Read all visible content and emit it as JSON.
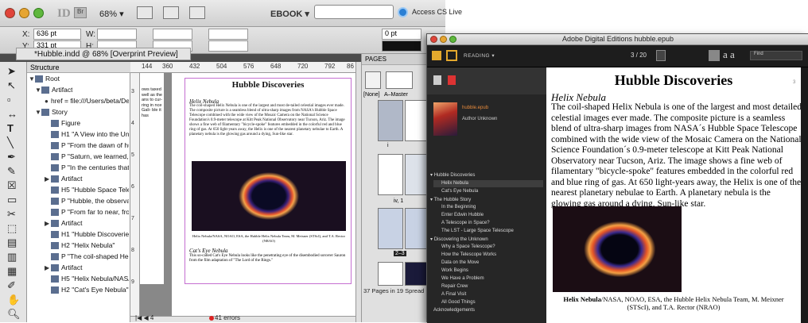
{
  "indesign": {
    "zoom": "68%",
    "ebook": "EBOOK ▾",
    "cs_live": "Access CS Live",
    "logo": "ID",
    "bridge": "Br",
    "control": {
      "x_label": "X:",
      "x_value": "636 pt",
      "y_label": "Y:",
      "y_value": "331 pt",
      "w_label": "W:",
      "h_label": "H:",
      "stroke_value": "0 pt"
    },
    "doc_tab": "*Hubble.indd @ 68% [Overprint Preview]",
    "structure": {
      "header": "Structure",
      "rows": [
        {
          "label": "Root"
        },
        {
          "label": "Artifact"
        },
        {
          "label": "href = file:///Users/beta/De"
        },
        {
          "label": "Story"
        },
        {
          "label": "Figure"
        },
        {
          "label": "H1  \"A View into the Uni"
        },
        {
          "label": "P  \"From the dawn of hu"
        },
        {
          "label": "P  \"Saturn, we learned, h"
        },
        {
          "label": "P  \"In the centuries that"
        },
        {
          "label": "Artifact"
        },
        {
          "label": "H5  \"Hubble Space Teles"
        },
        {
          "label": "P  \"Hubble, the observat"
        },
        {
          "label": "P  \"From far to near, fror"
        },
        {
          "label": "Artifact"
        },
        {
          "label": "H1  \"Hubble Discoveries"
        },
        {
          "label": "H2  \"Helix Nebula\""
        },
        {
          "label": "P  \"The coil-shaped Helix"
        },
        {
          "label": "Artifact"
        },
        {
          "label": "H5  \"Helix Nebula/NASA"
        },
        {
          "label": "H2  \"Cat's Eye Nebula\""
        }
      ]
    },
    "ruler_ticks": [
      "144",
      "360",
      "432",
      "504",
      "576",
      "648",
      "720",
      "792",
      "86"
    ],
    "ruler_left": [
      "3",
      "4",
      "5",
      "6",
      "7",
      "8",
      "9"
    ],
    "page": {
      "left_snip": "ows taxed well as the ans to cur- ring in nce Gali- ble it has",
      "title": "Hubble Discoveries",
      "sub": "Helix Nebula",
      "body": "The coil-shaped Helix Nebula is one of the largest and most de-tailed celestial images ever made. The composite picture is a seamless blend of ultra-sharp images from NASA's Hubble Space Telescope combined with the wide view of the Mosaic Camera on the National Science Foundation's 0.9-meter telescope at Kitt Peak National Observatory near Tucson, Ariz. The image shows a fine web of filamentary \"bicycle-spoke\" features embedded in the colorful red and blue ring of gas. At 650 light-years away, the Helix is one of the nearest planetary nebulae to Earth. A planetary nebula is the glowing gas around a dying, Sun-like star.",
      "caption": "Helix Nebula/NASA, NOAO, ESA, the Hubble Helix Nebula Team, M. Meixner (STScI), and T.A. Rector (NRAO)",
      "sub2": "Cat's Eye Nebula",
      "body2": "This so-called Cat's Eye Nebula looks like the penetrating eye of the disembodied sorcerer Sauron from the film adaptation of \"The Lord of the Rings.\""
    },
    "status_page": "4",
    "errors": "41 errors",
    "pages_panel": {
      "header": "PAGES",
      "none": "[None]",
      "master": "A–Master",
      "iv": "iv, 1",
      "spread": "2–3",
      "i": "i",
      "footer": "37 Pages in 19 Spread"
    }
  },
  "ade": {
    "title": "Adobe Digital Editions   hubble.epub",
    "reading": "READING",
    "page_num": "3  / 20",
    "find": "Find",
    "aa": "a  a",
    "book_title": "hubble.epub",
    "author": "Author Unknown",
    "toc": [
      {
        "label": "Hubble Discoveries",
        "level": 0
      },
      {
        "label": "Helix Nebula",
        "level": 1
      },
      {
        "label": "Cat's Eye Nebula",
        "level": 1
      },
      {
        "label": "The Hubble Story",
        "level": 0
      },
      {
        "label": "In the Beginning",
        "level": 1
      },
      {
        "label": "Enter Edwin Hubble",
        "level": 1
      },
      {
        "label": "A Telescope in Space?",
        "level": 1
      },
      {
        "label": "The LST - Large Space Telescope",
        "level": 1
      },
      {
        "label": "Discovering the Unknown",
        "level": 0
      },
      {
        "label": "Why a Space Telescope?",
        "level": 1
      },
      {
        "label": "How the Telescope Works",
        "level": 1
      },
      {
        "label": "Data on the Move",
        "level": 1
      },
      {
        "label": "Work Begins",
        "level": 1
      },
      {
        "label": "We Have a Problem",
        "level": 1
      },
      {
        "label": "Repair Crew",
        "level": 1
      },
      {
        "label": "A Final Visit",
        "level": 1
      },
      {
        "label": "All Good Things",
        "level": 1
      },
      {
        "label": "Acknowledgements",
        "level": 0
      }
    ],
    "content": {
      "title": "Hubble Discoveries",
      "page_marker": "3",
      "sub": "Helix Nebula",
      "body": "The coil-shaped Helix Nebula is one of the largest and most detailed celestial images ever made. The composite picture is a seamless blend of ultra-sharp images from NASA´s Hubble Space Telescope combined with the wide view of the Mosaic Camera on the National Science Foundation´s 0.9-meter telescope at Kitt Peak National Observatory near Tucson, Ariz. The image shows a fine web of filamentary \"bicycle-spoke\" features embedded in the colorful red and blue ring of gas. At 650 light-years away, the Helix is one of the nearest planetary nebulae to Earth. A planetary nebula is the glowing gas around a dying, Sun-like star.",
      "caption_bold": "Helix Nebula",
      "caption_rest": "/NASA, NOAO, ESA, the Hubble Helix Nebula Team, M. Meixner (STScI), and T.A. Rector (NRAO)"
    }
  }
}
